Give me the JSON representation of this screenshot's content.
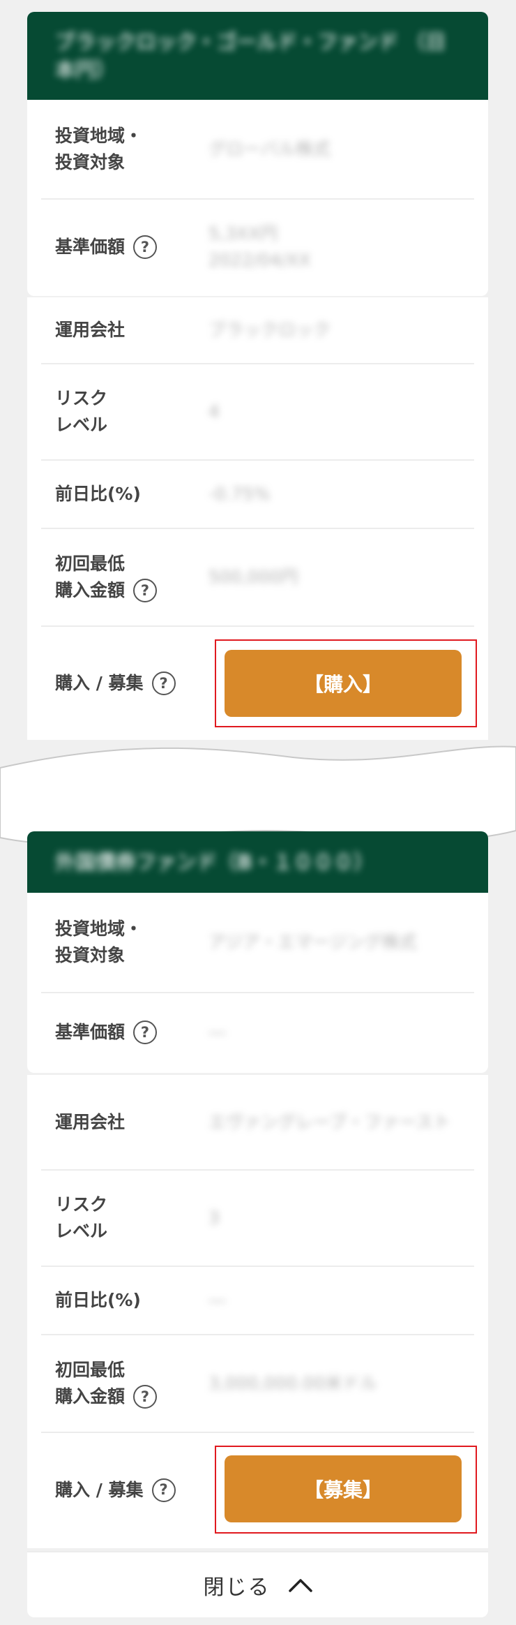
{
  "labels": {
    "region": "投資地域・\n投資対象",
    "nav": "基準価額",
    "company": "運用会社",
    "risk": "リスク\nレベル",
    "change": "前日比(%)",
    "min_amount": "初回最低\n購入金額",
    "purchase": "購入 / 募集",
    "help": "?"
  },
  "fund1": {
    "name": "ブラックロック・ゴールド・ファンド （日本円）",
    "region_value": "グローバル株式",
    "nav_value": "5,3XX円\n2022/04/XX",
    "company_value": "ブラックロック",
    "risk_value": "4",
    "change_value": "-0.75%",
    "min_value": "500,000円",
    "button_label": "【購入】"
  },
  "fund2": {
    "name": "外国債券ファンド（B・１０００）",
    "region_value": "アジア・エマージング株式",
    "nav_value": "―",
    "company_value": "エヴァングレーブ・ファースト",
    "risk_value": "3",
    "change_value": "―",
    "min_value": "3,000,000.00米ドル",
    "button_label": "【募集】"
  },
  "footer": {
    "close_label": "閉じる"
  },
  "colors": {
    "header": "#064a33",
    "button": "#d8892a",
    "highlight": "#e0191f"
  }
}
